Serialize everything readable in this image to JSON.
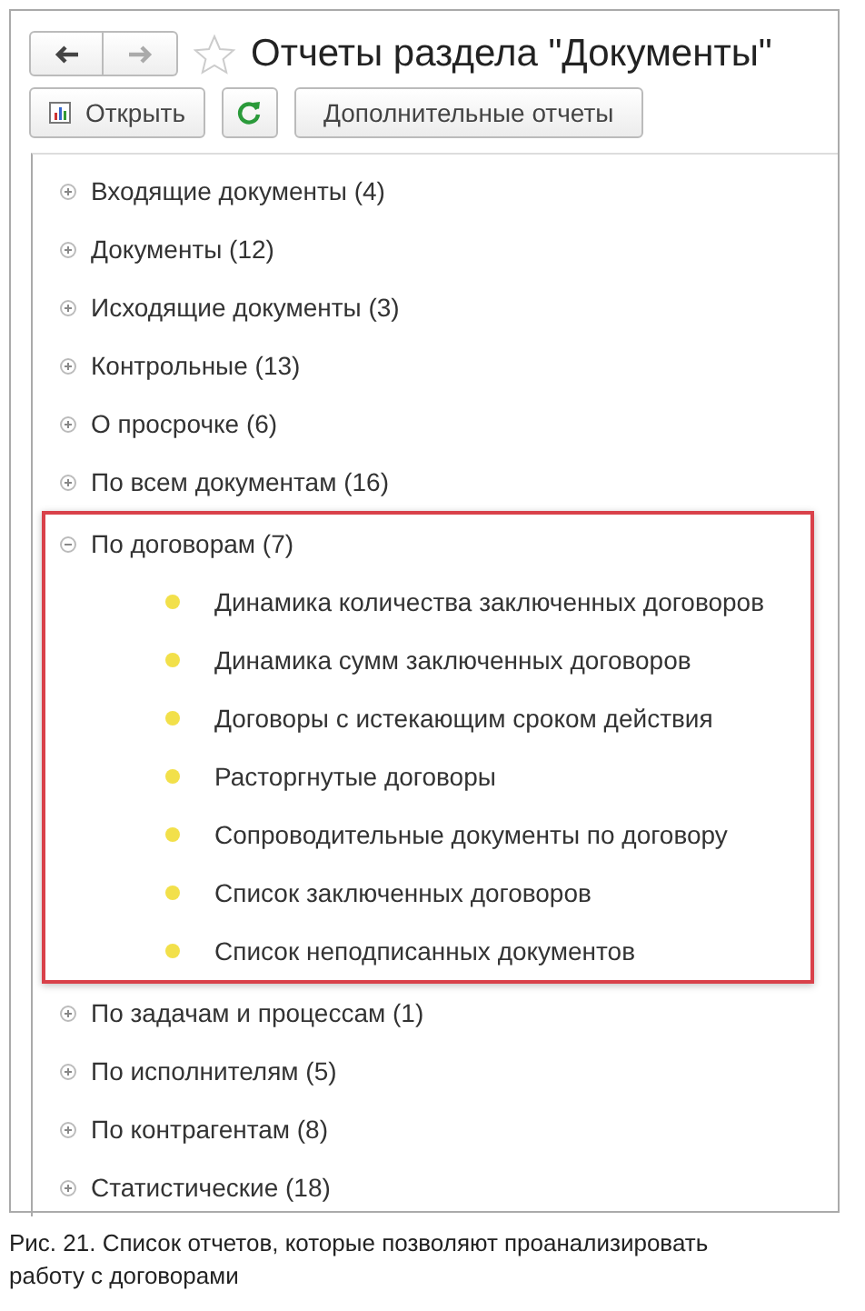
{
  "window": {
    "title": "Отчеты раздела \"Документы\"",
    "favorite": false
  },
  "toolbar": [
    {
      "kind": "open",
      "label": "Открыть"
    },
    {
      "kind": "refresh"
    },
    {
      "kind": "text",
      "label": "Дополнительные отчеты"
    }
  ],
  "groups": [
    {
      "label": "Входящие документы (4)",
      "expanded": false,
      "highlighted": false
    },
    {
      "label": "Документы (12)",
      "expanded": false,
      "highlighted": false
    },
    {
      "label": "Исходящие документы (3)",
      "expanded": false,
      "highlighted": false
    },
    {
      "label": "Контрольные (13)",
      "expanded": false,
      "highlighted": false
    },
    {
      "label": "О просрочке (6)",
      "expanded": false,
      "highlighted": false
    },
    {
      "label": "По всем документам (16)",
      "expanded": false,
      "highlighted": false
    },
    {
      "label": "По договорам (7)",
      "expanded": true,
      "highlighted": true,
      "children": [
        "Динамика количества заключенных договоров",
        "Динамика сумм заключенных договоров",
        "Договоры с истекающим сроком действия",
        "Расторгнутые договоры",
        "Сопроводительные документы по договору",
        "Список заключенных договоров",
        "Список неподписанных документов"
      ]
    },
    {
      "label": "По задачам и процессам (1)",
      "expanded": false,
      "highlighted": false
    },
    {
      "label": "По исполнителям (5)",
      "expanded": false,
      "highlighted": false
    },
    {
      "label": "По контрагентам (8)",
      "expanded": false,
      "highlighted": false
    },
    {
      "label": "Статистические (18)",
      "expanded": false,
      "highlighted": false
    }
  ],
  "caption": "Рис. 21. Список отчетов, которые позволяют проанализировать работу с договорами"
}
